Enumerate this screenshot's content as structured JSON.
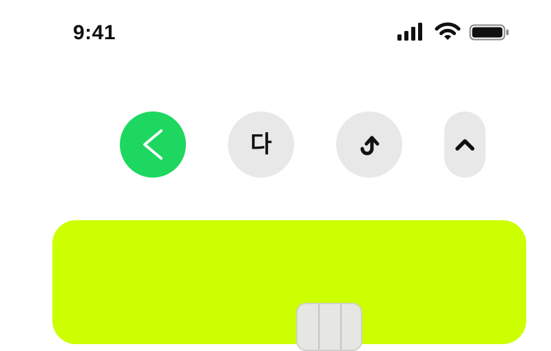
{
  "status_bar": {
    "time": "9:41",
    "icons": [
      "cellular-signal-icon",
      "wifi-icon",
      "battery-icon"
    ]
  },
  "actions": [
    {
      "icon": "chevron-left-icon",
      "color": "#1ed760"
    },
    {
      "glyph": "다",
      "icon": "translate-icon",
      "color": "#e8e8e8"
    },
    {
      "icon": "share-arrow-icon",
      "color": "#e8e8e8"
    },
    {
      "icon": "chevron-up-icon",
      "color": "#e8e8e8"
    }
  ],
  "card": {
    "color": "#ccff00",
    "chip_icon": "card-chip-icon"
  }
}
